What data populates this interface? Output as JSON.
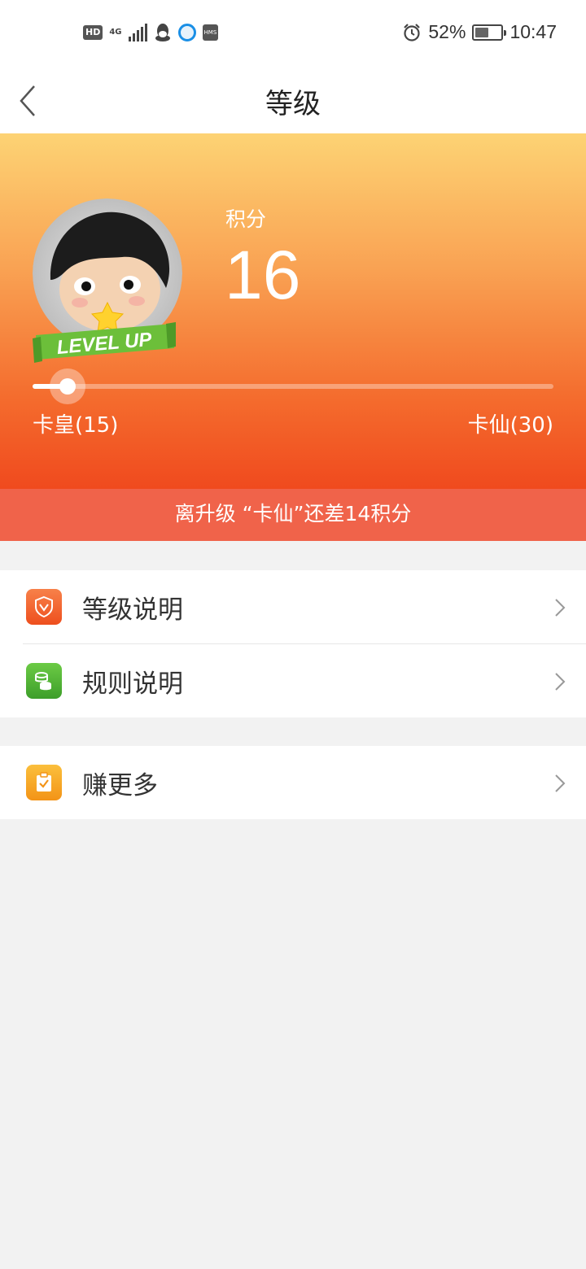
{
  "status_bar": {
    "network": "4G",
    "hd_badge": "HD",
    "hms_badge": "HMS",
    "battery_text": "52%",
    "battery_level": 0.52,
    "time": "10:47"
  },
  "header": {
    "title": "等级",
    "back_icon": "chevron-left-icon"
  },
  "profile": {
    "badge_text": "LEVEL UP",
    "score_label": "积分",
    "score_value": "16",
    "progress": {
      "min": 15,
      "max": 30,
      "current": 16,
      "current_level_label": "卡皇(15)",
      "next_level_label": "卡仙(30)"
    }
  },
  "hint": {
    "text": "离升级 “卡仙”还差14积分"
  },
  "menu_group_1": [
    {
      "label": "等级说明",
      "icon": "shield-v-icon",
      "color": "#f0622d"
    },
    {
      "label": "规则说明",
      "icon": "coins-icon",
      "color": "#4caf3a"
    }
  ],
  "menu_group_2": [
    {
      "label": "赚更多",
      "icon": "clipboard-check-icon",
      "color": "#f7a42a"
    }
  ],
  "colors": {
    "hero_top": "#fdd374",
    "hero_bottom": "#f04a1e",
    "hint_bar": "#f0634a",
    "page_bg": "#f2f2f2"
  }
}
